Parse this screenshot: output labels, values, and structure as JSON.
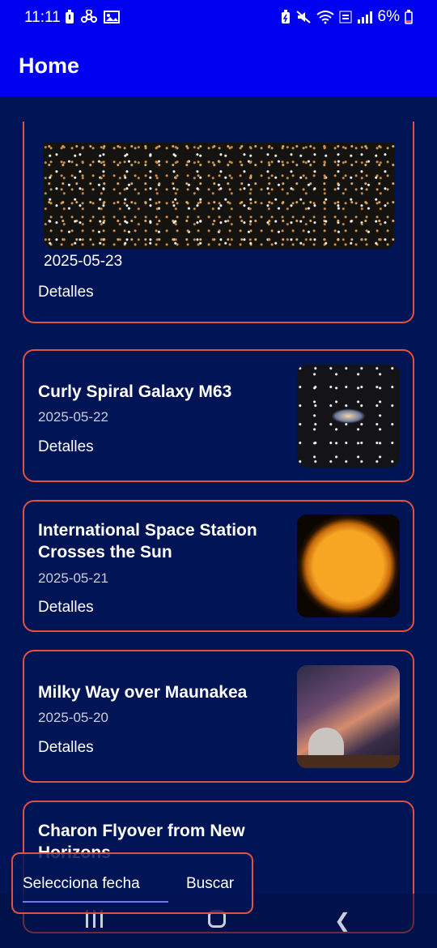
{
  "status": {
    "time": "11:11",
    "battery": "6%"
  },
  "appbar": {
    "title": "Home"
  },
  "cards": [
    {
      "date": "2025-05-23",
      "details": "Detalles"
    },
    {
      "title": "Curly Spiral Galaxy M63",
      "date": "2025-05-22",
      "details": "Detalles"
    },
    {
      "title": "International Space Station Crosses the Sun",
      "date": "2025-05-21",
      "details": "Detalles"
    },
    {
      "title": "Milky Way over Maunakea",
      "date": "2025-05-20",
      "details": "Detalles"
    },
    {
      "title": "Charon Flyover from New Horizons"
    }
  ],
  "bottom": {
    "date_select": "Selecciona fecha",
    "search": "Buscar"
  },
  "colors": {
    "background": "#011456",
    "appbar": "#0000f0",
    "card_border": "#e0533f"
  }
}
